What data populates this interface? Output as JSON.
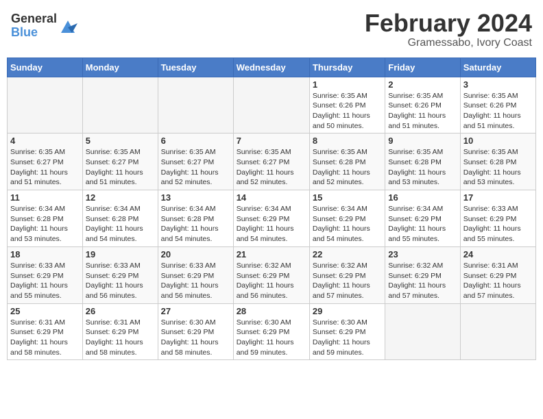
{
  "logo": {
    "general": "General",
    "blue": "Blue"
  },
  "header": {
    "title": "February 2024",
    "location": "Gramessabo, Ivory Coast"
  },
  "weekdays": [
    "Sunday",
    "Monday",
    "Tuesday",
    "Wednesday",
    "Thursday",
    "Friday",
    "Saturday"
  ],
  "weeks": [
    [
      {
        "day": "",
        "info": ""
      },
      {
        "day": "",
        "info": ""
      },
      {
        "day": "",
        "info": ""
      },
      {
        "day": "",
        "info": ""
      },
      {
        "day": "1",
        "info": "Sunrise: 6:35 AM\nSunset: 6:26 PM\nDaylight: 11 hours and 50 minutes."
      },
      {
        "day": "2",
        "info": "Sunrise: 6:35 AM\nSunset: 6:26 PM\nDaylight: 11 hours and 51 minutes."
      },
      {
        "day": "3",
        "info": "Sunrise: 6:35 AM\nSunset: 6:26 PM\nDaylight: 11 hours and 51 minutes."
      }
    ],
    [
      {
        "day": "4",
        "info": "Sunrise: 6:35 AM\nSunset: 6:27 PM\nDaylight: 11 hours and 51 minutes."
      },
      {
        "day": "5",
        "info": "Sunrise: 6:35 AM\nSunset: 6:27 PM\nDaylight: 11 hours and 51 minutes."
      },
      {
        "day": "6",
        "info": "Sunrise: 6:35 AM\nSunset: 6:27 PM\nDaylight: 11 hours and 52 minutes."
      },
      {
        "day": "7",
        "info": "Sunrise: 6:35 AM\nSunset: 6:27 PM\nDaylight: 11 hours and 52 minutes."
      },
      {
        "day": "8",
        "info": "Sunrise: 6:35 AM\nSunset: 6:28 PM\nDaylight: 11 hours and 52 minutes."
      },
      {
        "day": "9",
        "info": "Sunrise: 6:35 AM\nSunset: 6:28 PM\nDaylight: 11 hours and 53 minutes."
      },
      {
        "day": "10",
        "info": "Sunrise: 6:35 AM\nSunset: 6:28 PM\nDaylight: 11 hours and 53 minutes."
      }
    ],
    [
      {
        "day": "11",
        "info": "Sunrise: 6:34 AM\nSunset: 6:28 PM\nDaylight: 11 hours and 53 minutes."
      },
      {
        "day": "12",
        "info": "Sunrise: 6:34 AM\nSunset: 6:28 PM\nDaylight: 11 hours and 54 minutes."
      },
      {
        "day": "13",
        "info": "Sunrise: 6:34 AM\nSunset: 6:28 PM\nDaylight: 11 hours and 54 minutes."
      },
      {
        "day": "14",
        "info": "Sunrise: 6:34 AM\nSunset: 6:29 PM\nDaylight: 11 hours and 54 minutes."
      },
      {
        "day": "15",
        "info": "Sunrise: 6:34 AM\nSunset: 6:29 PM\nDaylight: 11 hours and 54 minutes."
      },
      {
        "day": "16",
        "info": "Sunrise: 6:34 AM\nSunset: 6:29 PM\nDaylight: 11 hours and 55 minutes."
      },
      {
        "day": "17",
        "info": "Sunrise: 6:33 AM\nSunset: 6:29 PM\nDaylight: 11 hours and 55 minutes."
      }
    ],
    [
      {
        "day": "18",
        "info": "Sunrise: 6:33 AM\nSunset: 6:29 PM\nDaylight: 11 hours and 55 minutes."
      },
      {
        "day": "19",
        "info": "Sunrise: 6:33 AM\nSunset: 6:29 PM\nDaylight: 11 hours and 56 minutes."
      },
      {
        "day": "20",
        "info": "Sunrise: 6:33 AM\nSunset: 6:29 PM\nDaylight: 11 hours and 56 minutes."
      },
      {
        "day": "21",
        "info": "Sunrise: 6:32 AM\nSunset: 6:29 PM\nDaylight: 11 hours and 56 minutes."
      },
      {
        "day": "22",
        "info": "Sunrise: 6:32 AM\nSunset: 6:29 PM\nDaylight: 11 hours and 57 minutes."
      },
      {
        "day": "23",
        "info": "Sunrise: 6:32 AM\nSunset: 6:29 PM\nDaylight: 11 hours and 57 minutes."
      },
      {
        "day": "24",
        "info": "Sunrise: 6:31 AM\nSunset: 6:29 PM\nDaylight: 11 hours and 57 minutes."
      }
    ],
    [
      {
        "day": "25",
        "info": "Sunrise: 6:31 AM\nSunset: 6:29 PM\nDaylight: 11 hours and 58 minutes."
      },
      {
        "day": "26",
        "info": "Sunrise: 6:31 AM\nSunset: 6:29 PM\nDaylight: 11 hours and 58 minutes."
      },
      {
        "day": "27",
        "info": "Sunrise: 6:30 AM\nSunset: 6:29 PM\nDaylight: 11 hours and 58 minutes."
      },
      {
        "day": "28",
        "info": "Sunrise: 6:30 AM\nSunset: 6:29 PM\nDaylight: 11 hours and 59 minutes."
      },
      {
        "day": "29",
        "info": "Sunrise: 6:30 AM\nSunset: 6:29 PM\nDaylight: 11 hours and 59 minutes."
      },
      {
        "day": "",
        "info": ""
      },
      {
        "day": "",
        "info": ""
      }
    ]
  ]
}
